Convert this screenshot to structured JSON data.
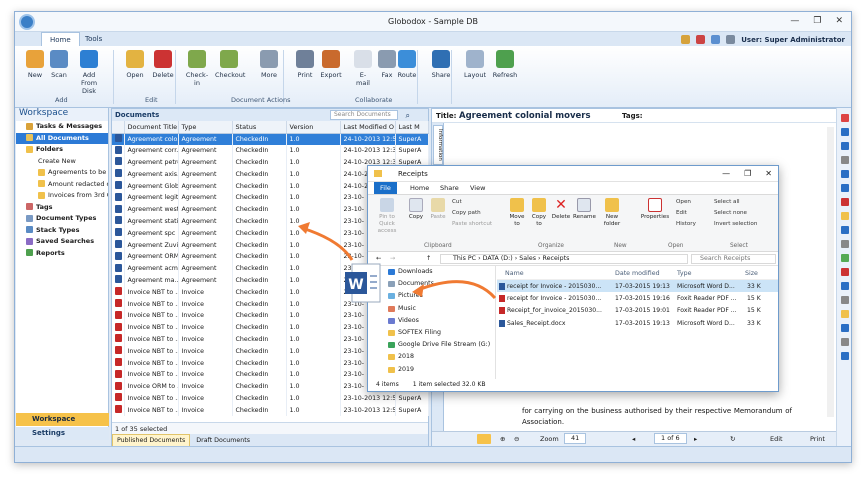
{
  "app": {
    "title": "Globodox - Sample DB",
    "tabs": [
      "Home",
      "Tools"
    ],
    "user": "User: Super Administrator",
    "window_controls": [
      "—",
      "❐",
      "✕"
    ]
  },
  "ribbon": {
    "buttons": [
      {
        "label": "New",
        "icon": "new-icon",
        "color": "#e8a23a"
      },
      {
        "label": "Scan",
        "icon": "scan-icon",
        "color": "#5a8bc4"
      },
      {
        "label": "Add From\nDisk",
        "icon": "add-icon",
        "color": "#2d7fd3"
      },
      {
        "label": "Open",
        "icon": "open-icon",
        "color": "#e3b341"
      },
      {
        "label": "Delete",
        "icon": "delete-icon",
        "color": "#cc3333"
      },
      {
        "label": "Check-\nin",
        "icon": "checkin-icon",
        "color": "#7fa84c"
      },
      {
        "label": "Checkout",
        "icon": "checkout-icon",
        "color": "#7fa84c"
      },
      {
        "label": "More",
        "icon": "more-icon",
        "color": "#8a9bb0"
      },
      {
        "label": "Print",
        "icon": "print-icon",
        "color": "#6f8099"
      },
      {
        "label": "Export",
        "icon": "export-icon",
        "color": "#c96a2d"
      },
      {
        "label": "E-\nmail",
        "icon": "email-icon",
        "color": "#d9dfe8"
      },
      {
        "label": "Fax",
        "icon": "fax-icon",
        "color": "#8a9bb0"
      },
      {
        "label": "Route",
        "icon": "route-icon",
        "color": "#3c8ed9"
      },
      {
        "label": "Share",
        "icon": "share-icon",
        "color": "#2f6fb3"
      },
      {
        "label": "Layout",
        "icon": "layout-icon",
        "color": "#9fb3cc"
      },
      {
        "label": "Refresh",
        "icon": "refresh-icon",
        "color": "#4ea04e"
      }
    ],
    "groups": [
      "Add",
      "Edit",
      "Document Actions",
      "Collaborate"
    ]
  },
  "workspace": {
    "title": "Workspace",
    "tree": [
      {
        "label": "Tasks & Messages",
        "bold": true,
        "indent": 0
      },
      {
        "label": "All Documents",
        "bold": true,
        "indent": 0,
        "selected": true
      },
      {
        "label": "Folders",
        "bold": true,
        "indent": 0
      },
      {
        "label": "Create New",
        "bold": false,
        "indent": 1
      },
      {
        "label": "Agreements to be revie",
        "bold": false,
        "indent": 1
      },
      {
        "label": "Amount redacted chec",
        "bold": false,
        "indent": 1
      },
      {
        "label": "Invoices from 3rd Quar",
        "bold": false,
        "indent": 1
      },
      {
        "label": "Tags",
        "bold": true,
        "indent": 0
      },
      {
        "label": "Document Types",
        "bold": true,
        "indent": 0
      },
      {
        "label": "Stack Types",
        "bold": true,
        "indent": 0
      },
      {
        "label": "Saved Searches",
        "bold": true,
        "indent": 0
      },
      {
        "label": "Reports",
        "bold": true,
        "indent": 0
      }
    ],
    "bottom": [
      "Workspace",
      "Settings"
    ]
  },
  "documents": {
    "title": "Documents",
    "search_placeholder": "Search Documents",
    "columns": [
      "Document Title",
      "Type",
      "Status",
      "Version",
      "Last Modified O",
      "Last M"
    ],
    "rows": [
      [
        "Agreement colo...",
        "Agreement",
        "CheckedIn",
        "1.0",
        "24-10-2013 12:54",
        "SuperA",
        "word",
        true
      ],
      [
        "Agreement corr...",
        "Agreement",
        "CheckedIn",
        "1.0",
        "24-10-2013 12:34",
        "SuperA",
        "word",
        false
      ],
      [
        "Agreement petrox",
        "Agreement",
        "CheckedIn",
        "1.0",
        "24-10-2013 12:33",
        "SuperA",
        "word",
        false
      ],
      [
        "Agreement axis...",
        "Agreement",
        "CheckedIn",
        "1.0",
        "24-10-2013 12:36",
        "SuperA",
        "word",
        false
      ],
      [
        "Agreement Glob...",
        "Agreement",
        "CheckedIn",
        "1.0",
        "24-10-2013 12:34",
        "SuperA",
        "word",
        false
      ],
      [
        "Agreement legiti...",
        "Agreement",
        "CheckedIn",
        "1.0",
        "23-10-",
        "",
        "word",
        false
      ],
      [
        "Agreement west...",
        "Agreement",
        "CheckedIn",
        "1.0",
        "23-10-",
        "",
        "word",
        false
      ],
      [
        "Agreement stati...",
        "Agreement",
        "CheckedIn",
        "1.0",
        "23-10-",
        "",
        "word",
        false
      ],
      [
        "Agreement spc",
        "Agreement",
        "CheckedIn",
        "1.0",
        "23-10-",
        "",
        "word",
        false
      ],
      [
        "Agreement Zuvixo",
        "Agreement",
        "CheckedIn",
        "1.0",
        "23-10-",
        "",
        "word",
        false
      ],
      [
        "Agreement ORM...",
        "Agreement",
        "CheckedIn",
        "1.0",
        "23-10-",
        "",
        "word",
        false
      ],
      [
        "Agreement acme",
        "Agreement",
        "CheckedIn",
        "1.0",
        "23-10-",
        "",
        "word",
        false
      ],
      [
        "Agreement ma...",
        "Agreement",
        "CheckedIn",
        "1.0",
        "23-10-",
        "",
        "word",
        false
      ],
      [
        "Invoice NBT to ...",
        "Invoice",
        "CheckedIn",
        "1.0",
        "23-10-",
        "",
        "pdf",
        false
      ],
      [
        "Invoice NBT to ...",
        "Invoice",
        "CheckedIn",
        "1.0",
        "23-10-",
        "",
        "pdf",
        false
      ],
      [
        "Invoice NBT to ...",
        "Invoice",
        "CheckedIn",
        "1.0",
        "23-10-",
        "",
        "pdf",
        false
      ],
      [
        "Invoice NBT to ...",
        "Invoice",
        "CheckedIn",
        "1.0",
        "23-10-",
        "",
        "pdf",
        false
      ],
      [
        "Invoice NBT to ...",
        "Invoice",
        "CheckedIn",
        "1.0",
        "23-10-",
        "",
        "pdf",
        false
      ],
      [
        "Invoice NBT to ...",
        "Invoice",
        "CheckedIn",
        "1.0",
        "23-10-",
        "",
        "pdf",
        false
      ],
      [
        "Invoice NBT to ...",
        "Invoice",
        "CheckedIn",
        "1.0",
        "23-10-",
        "",
        "pdf",
        false
      ],
      [
        "Invoice NBT to ...",
        "Invoice",
        "CheckedIn",
        "1.0",
        "23-10-",
        "",
        "pdf",
        false
      ],
      [
        "Invoice ORM to ...",
        "Invoice",
        "CheckedIn",
        "1.0",
        "23-10-",
        "",
        "pdf",
        false
      ],
      [
        "Invoice NBT to ...",
        "Invoice",
        "CheckedIn",
        "1.0",
        "23-10-2013 12:56",
        "SuperA",
        "pdf",
        false
      ],
      [
        "Invoice NBT to ...",
        "Invoice",
        "CheckedIn",
        "1.0",
        "23-10-2013 12:59",
        "SuperA",
        "pdf",
        false
      ]
    ],
    "footer": "1 of 35 selected",
    "bottom_tabs": [
      "Published Documents",
      "Draft Documents"
    ]
  },
  "preview": {
    "title_label": "Title:",
    "title": "Agreement colonial movers",
    "tags_label": "Tags:",
    "info_tab": "Information",
    "page_text": "for carrying on the business authorised by their respective Memorandum of Association.",
    "zoom_label": "Zoom",
    "zoom_value": "41",
    "page_of": "1 of 6",
    "edit_label": "Edit",
    "print_label": "Print"
  },
  "explorer": {
    "title": "Receipts",
    "tabs": [
      "File",
      "Home",
      "Share",
      "View"
    ],
    "ribbon": {
      "pin": "Pin to Quick\naccess",
      "copy": "Copy",
      "paste": "Paste",
      "cut": "Cut",
      "copy_path": "Copy path",
      "paste_shortcut": "Paste shortcut",
      "move_to": "Move\nto",
      "copy_to": "Copy\nto",
      "delete": "Delete",
      "rename": "Rename",
      "new_folder": "New\nfolder",
      "properties": "Properties",
      "open": "Open",
      "edit": "Edit",
      "history": "History",
      "select_all": "Select all",
      "select_none": "Select none",
      "invert_selection": "Invert selection",
      "groups": [
        "Clipboard",
        "Organize",
        "New",
        "Open",
        "Select"
      ]
    },
    "path": [
      "This PC",
      "DATA (D:)",
      "Sales",
      "Receipts"
    ],
    "search_placeholder": "Search Receipts",
    "nav": [
      "Downloads",
      "Documents",
      "Pictures",
      "Music",
      "Videos",
      "SOFTEX Filing",
      "Google Drive File Stream (G:)",
      "2018",
      "2019"
    ],
    "columns": [
      "Name",
      "Date modified",
      "Type",
      "Size"
    ],
    "files": [
      {
        "name": "receipt for Invoice - 2015030...",
        "date": "17-03-2015 19:13",
        "type": "Microsoft Word D...",
        "size": "33 K",
        "selected": true,
        "kind": "word"
      },
      {
        "name": "receipt for Invoice - 2015030...",
        "date": "17-03-2015 19:16",
        "type": "Foxit Reader PDF ...",
        "size": "15 K",
        "selected": false,
        "kind": "pdf"
      },
      {
        "name": "Receipt_for_invoice_2015030...",
        "date": "17-03-2015 19:01",
        "type": "Foxit Reader PDF ...",
        "size": "15 K",
        "selected": false,
        "kind": "pdf"
      },
      {
        "name": "Sales_Receipt.docx",
        "date": "17-03-2015 19:13",
        "type": "Microsoft Word D...",
        "size": "33 K",
        "selected": false,
        "kind": "word"
      }
    ],
    "status": [
      "4 items",
      "1 item selected  32.0 KB"
    ]
  },
  "colors": {
    "accent": "#2f7fd8",
    "word": "#2b579a",
    "pdf": "#c62828",
    "arrow": "#f07a32"
  }
}
